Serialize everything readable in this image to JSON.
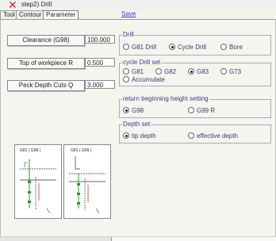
{
  "window": {
    "title": "step2) Drill"
  },
  "tabs": [
    {
      "label": "Tool"
    },
    {
      "label": "Contour"
    },
    {
      "label": "Parameter"
    }
  ],
  "save_label": "Save",
  "fields": {
    "clearance": {
      "label": "Clearance (G98)",
      "value": "100.000"
    },
    "top_of_workpiece": {
      "label": "Top of workpiece R",
      "value": "0.500"
    },
    "peck_depth": {
      "label": "Peck Depth Cuts Q",
      "value": "3.000"
    }
  },
  "drill_group": {
    "label": "Drill",
    "options": [
      {
        "label": "G81 Drill",
        "selected": false
      },
      {
        "label": "Cycle Drill",
        "selected": true
      },
      {
        "label": "Bore",
        "selected": false
      }
    ]
  },
  "cycle_group": {
    "label": "cycle Drill set",
    "options": [
      {
        "label": "G81",
        "selected": false
      },
      {
        "label": "G82",
        "selected": false
      },
      {
        "label": "G83",
        "selected": true
      },
      {
        "label": "G73",
        "selected": false
      },
      {
        "label": "Accumulate",
        "selected": false
      }
    ]
  },
  "return_group": {
    "label": "return beginning height setting",
    "options": [
      {
        "label": "G98",
        "selected": true
      },
      {
        "label": "G99 R",
        "selected": false
      }
    ]
  },
  "depth_group": {
    "label": "Depth set",
    "options": [
      {
        "label": "tip depth",
        "selected": true
      },
      {
        "label": "effective depth",
        "selected": false
      }
    ]
  },
  "diagrams": [
    {
      "caption": "G81 ( G98 )"
    },
    {
      "caption": "G81 ( G99 )"
    }
  ],
  "colors": {
    "close": "#e02020",
    "accent": "#3a3a8a"
  }
}
